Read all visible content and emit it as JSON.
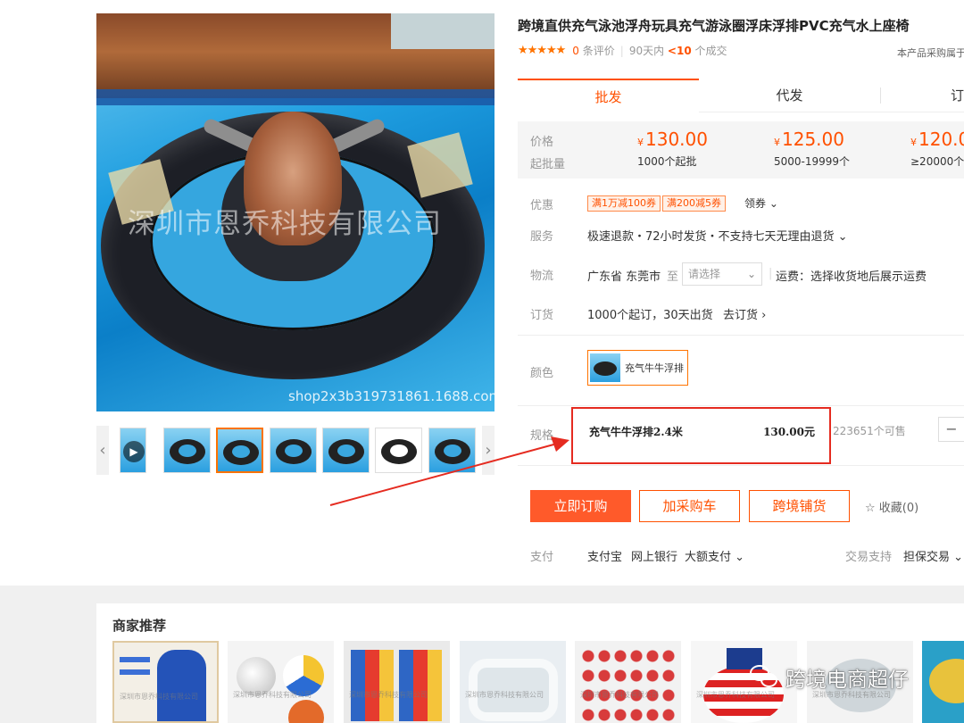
{
  "product": {
    "title": "跨境直供充气泳池浮舟玩具充气游泳圈浮床浮排PVC充气水上座椅",
    "stars": "★★★★★",
    "review_count": "0",
    "review_label": "条评价",
    "sales_period": "90天内",
    "sales_count": "<10",
    "sales_label": "个成交",
    "belong_note": "本产品采购属于",
    "image_watermark": "深圳市恩乔科技有限公司",
    "image_shop": "shop2x3b319731861.1688.com"
  },
  "tabs": [
    "批发",
    "代发",
    "订"
  ],
  "price": {
    "price_label": "价格",
    "qty_label": "起批量",
    "currency": "¥",
    "tiers": [
      {
        "price": "130.00",
        "qty": "1000个起批"
      },
      {
        "price": "125.00",
        "qty": "5000-19999个"
      },
      {
        "price": "120.0",
        "qty": "≥20000个"
      }
    ]
  },
  "discount": {
    "label": "优惠",
    "coupons": [
      "满1万减100券",
      "满200减5券"
    ],
    "claim": "领券 ⌄"
  },
  "service": {
    "label": "服务",
    "text": "极速退款・72小时发货・不支持七天无理由退货 ⌄"
  },
  "logistics": {
    "label": "物流",
    "origin": "广东省 东莞市",
    "to": "至",
    "select_placeholder": "请选择",
    "freight": "运费：选择收货地后展示运费"
  },
  "order": {
    "label": "订货",
    "text": "1000个起订，30天出货",
    "link": "去订货 ›"
  },
  "color": {
    "label": "颜色",
    "option": "充气牛牛浮排"
  },
  "spec": {
    "label": "规格",
    "name": "充气牛牛浮排2.4米",
    "price": "130.00元",
    "stock": "223651个可售",
    "minus": "−"
  },
  "actions": {
    "buy_now": "立即订购",
    "add_cart": "加采购车",
    "cross_border": "跨境铺货",
    "favorite": "收藏(0)"
  },
  "payment": {
    "label": "支付",
    "methods": [
      "支付宝",
      "网上银行",
      "大额支付 ⌄"
    ],
    "trade_label": "交易支持",
    "trade_value": "担保交易 ⌄"
  },
  "recommend": {
    "title": "商家推荐",
    "item_watermark": "深圳市恩乔科技有限公司"
  },
  "overlay": {
    "text": "跨境电商超仔"
  },
  "colors": {
    "accent": "#ff5000",
    "annotation_red": "#e52b20"
  }
}
